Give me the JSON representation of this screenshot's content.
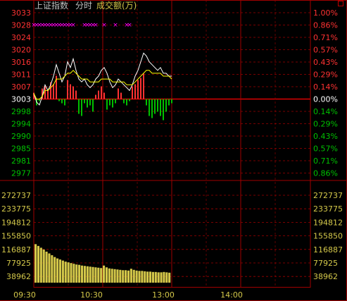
{
  "header": {
    "index_name": "上证指数",
    "mode_label": "分时",
    "volume_label": "成交额(万)"
  },
  "colors": {
    "background": "#000000",
    "grid": "#a00000",
    "up": "#ff3232",
    "down": "#00c000",
    "flat": "#ffffff",
    "price_line": "#ffffff",
    "avg_line": "#ffff00",
    "volume_bar": "#d4c84a",
    "marker": "#ff00ff"
  },
  "chart_data": [
    {
      "type": "line",
      "title": "",
      "preclose": 3003,
      "y_ticks_left": [
        "3033",
        "3028",
        "3024",
        "3020",
        "3016",
        "3011",
        "3007",
        "3003",
        "2998",
        "2994",
        "2990",
        "2985",
        "2981",
        "2977"
      ],
      "y_ticks_right": [
        "1.00%",
        "0.86%",
        "0.71%",
        "0.57%",
        "0.43%",
        "0.29%",
        "0.14%",
        "0.00%",
        "0.14%",
        "0.29%",
        "0.43%",
        "0.57%",
        "0.71%",
        "0.86%"
      ],
      "ylim": [
        2973,
        3033
      ],
      "x_ticks": [
        "09:30",
        "10:30",
        "13:00",
        "14:00"
      ],
      "series": [
        {
          "role": "price",
          "values": [
            3003,
            3000,
            2999,
            3002,
            3006,
            3004,
            3006,
            3009,
            3013,
            3010,
            3007,
            3009,
            3014,
            3012,
            3015,
            3011,
            3008,
            3007,
            3008,
            3006,
            3005,
            3006,
            3008,
            3009,
            3011,
            3012,
            3010,
            3007,
            3005,
            3006,
            3008,
            3007,
            3006,
            3005,
            3004,
            3006,
            3009,
            3011,
            3014,
            3017,
            3016,
            3014,
            3013,
            3012,
            3011,
            3012,
            3010,
            3010,
            3009,
            3009
          ]
        },
        {
          "role": "average",
          "values": [
            3003,
            3001,
            3001,
            3002,
            3004,
            3004,
            3005,
            3006,
            3008,
            3008,
            3008,
            3009,
            3010,
            3010,
            3011,
            3010,
            3009,
            3008,
            3008,
            3008,
            3007,
            3007,
            3007,
            3007,
            3008,
            3008,
            3008,
            3008,
            3007,
            3007,
            3007,
            3007,
            3007,
            3006,
            3006,
            3006,
            3007,
            3008,
            3009,
            3010,
            3011,
            3011,
            3010,
            3010,
            3010,
            3010,
            3009,
            3009,
            3009,
            3008
          ]
        }
      ],
      "markers": [
        true,
        true,
        true,
        true,
        true,
        true,
        true,
        true,
        true,
        true,
        true,
        true,
        true,
        true,
        true,
        false,
        false,
        false,
        true,
        true,
        true,
        true,
        true,
        false,
        false,
        true,
        false,
        false,
        false,
        true,
        false,
        false,
        false,
        true,
        true,
        false,
        false,
        false,
        false,
        false,
        false,
        false,
        false,
        false,
        false,
        false,
        false,
        false,
        false,
        false
      ],
      "buy_sell_pressure": [
        3,
        -3,
        -1,
        5,
        6,
        4,
        8,
        7,
        11,
        -1,
        -2,
        -3,
        9,
        7,
        6,
        4,
        -7,
        -8,
        -2,
        -4,
        -3,
        -6,
        2,
        4,
        6,
        3,
        -5,
        -3,
        -4,
        -2,
        5,
        3,
        -2,
        -3,
        -1,
        6,
        7,
        9,
        10,
        12,
        -3,
        -8,
        -9,
        -7,
        -6,
        -8,
        -10,
        -6,
        -3,
        -2
      ]
    },
    {
      "type": "bar",
      "title": "成交额(万)",
      "y_ticks": [
        "272737",
        "233775",
        "194812",
        "155850",
        "116887",
        "77925",
        "38962"
      ],
      "ylim": [
        0,
        272737
      ],
      "x_ticks": [
        "09:30",
        "10:30",
        "13:00",
        "14:00"
      ],
      "values": [
        108000,
        103000,
        98000,
        93000,
        87000,
        82000,
        77000,
        72000,
        68000,
        65000,
        62000,
        59000,
        57000,
        55000,
        53000,
        51000,
        50000,
        48000,
        47000,
        46000,
        45000,
        44000,
        43000,
        42000,
        41000,
        48000,
        43000,
        40000,
        39000,
        38000,
        37000,
        36000,
        35000,
        35000,
        34000,
        39000,
        36000,
        34000,
        33000,
        33000,
        32000,
        31000,
        31000,
        30000,
        30000,
        29000,
        29000,
        30000,
        29000,
        28000
      ]
    }
  ]
}
